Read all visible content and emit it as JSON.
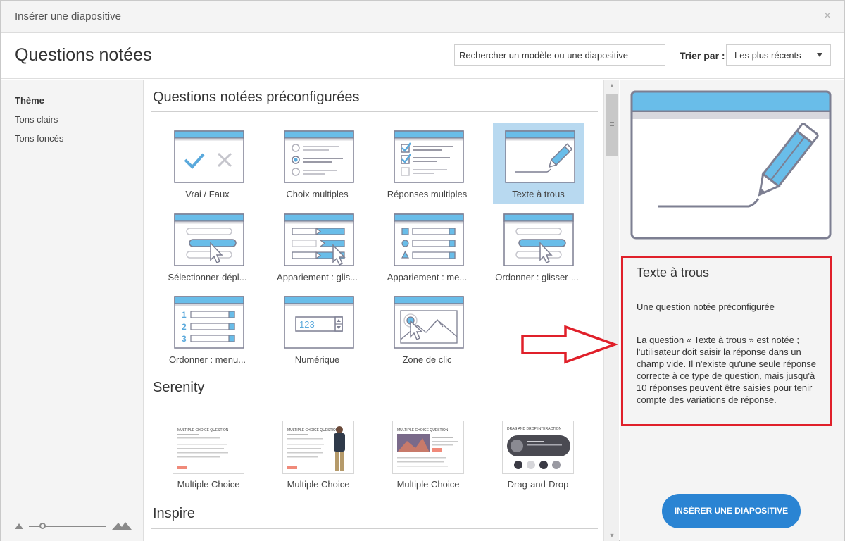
{
  "window": {
    "title": "Insérer une diapositive",
    "close_glyph": "×"
  },
  "header": {
    "heading": "Questions notées",
    "search_placeholder": "Rechercher un modèle ou une diapositive",
    "sort_label": "Trier par :",
    "sort_value": "Les plus récents"
  },
  "sidebar": {
    "items": [
      {
        "label": "Thème",
        "active": true
      },
      {
        "label": "Tons clairs",
        "active": false
      },
      {
        "label": "Tons foncés",
        "active": false
      }
    ],
    "zoom_level": 0.2
  },
  "sections": {
    "preconfigured": {
      "title": "Questions notées préconfigurées",
      "tiles": [
        {
          "label": "Vrai / Faux",
          "icon": "true-false-icon"
        },
        {
          "label": "Choix multiples",
          "icon": "multiple-choice-icon"
        },
        {
          "label": "Réponses multiples",
          "icon": "multiple-response-icon"
        },
        {
          "label": "Texte à trous",
          "icon": "fill-in-blank-icon",
          "selected": true
        },
        {
          "label": "Sélectionner-dépl...",
          "icon": "drag-select-icon"
        },
        {
          "label": "Appariement : glis...",
          "icon": "matching-drag-icon"
        },
        {
          "label": "Appariement : me...",
          "icon": "matching-dropdown-icon"
        },
        {
          "label": "Ordonner : glisser-...",
          "icon": "sequence-drag-icon"
        },
        {
          "label": "Ordonner : menu...",
          "icon": "sequence-dropdown-icon"
        },
        {
          "label": "Numérique",
          "icon": "numeric-icon",
          "number": "123"
        },
        {
          "label": "Zone de clic",
          "icon": "hotspot-icon"
        }
      ]
    },
    "serenity": {
      "title": "Serenity",
      "tiles": [
        {
          "label": "Multiple Choice",
          "slide_title": "MULTIPLE CHOICE QUESTION"
        },
        {
          "label": "Multiple Choice",
          "slide_title": "MULTIPLE CHOICE QUESTION"
        },
        {
          "label": "Multiple Choice",
          "slide_title": "MULTIPLE CHOICE QUESTION"
        },
        {
          "label": "Drag-and-Drop",
          "slide_title": "DRAG AND DROP INTERACTION"
        }
      ]
    },
    "inspire": {
      "title": "Inspire"
    }
  },
  "scrollbar": {
    "up": "▲",
    "down": "▼"
  },
  "preview": {
    "icon": "fill-in-blank-icon",
    "title": "Texte à trous",
    "subtitle": "Une question notée préconfigurée",
    "description": "La question « Texte à trous » est notée ; l'utilisateur doit saisir la réponse dans un champ vide. Il n'existe qu'une seule réponse correcte à ce type de question, mais jusqu'à 10 réponses peuvent être saisies pour tenir compte des variations de réponse.",
    "insert_button": "INSÉRER UNE DIAPOSITIVE"
  },
  "colors": {
    "accent_blue": "#69bde9",
    "icon_outline": "#7d7f92",
    "selection": "#b8d9f0",
    "button": "#2a84d3",
    "highlight_red": "#e0202a"
  }
}
